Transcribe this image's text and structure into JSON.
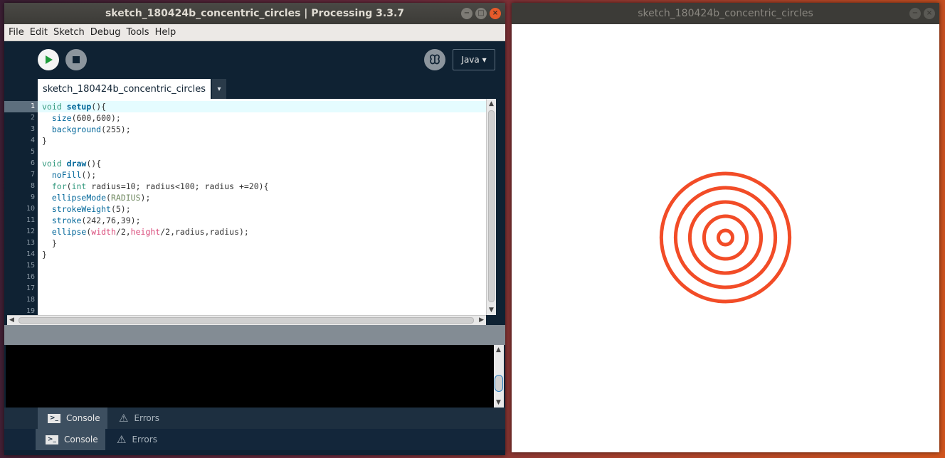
{
  "ide": {
    "title": "sketch_180424b_concentric_circles | Processing 3.3.7",
    "window_buttons": [
      "−",
      "□",
      "×"
    ],
    "menu": [
      "File",
      "Edit",
      "Sketch",
      "Debug",
      "Tools",
      "Help"
    ],
    "toolbar": {
      "run_icon": "play-icon",
      "stop_icon": "stop-icon",
      "debugger_icon": "butterfly-icon",
      "mode": "Java ▾"
    },
    "tab": {
      "label": "sketch_180424b_concentric_circles",
      "menu_arrow": "▾"
    },
    "line_numbers": [
      "1",
      "2",
      "3",
      "4",
      "5",
      "6",
      "7",
      "8",
      "9",
      "10",
      "11",
      "12",
      "13",
      "14",
      "15",
      "16",
      "17",
      "18",
      "19"
    ],
    "code": [
      "void setup(){",
      "  size(600,600);",
      "  background(255);",
      "}",
      "",
      "void draw(){",
      "  noFill();",
      "  for(int radius=10; radius<100; radius +=20){",
      "  ellipseMode(RADIUS);",
      "  strokeWeight(5);",
      "  stroke(242,76,39);",
      "  ellipse(width/2,height/2,radius,radius);",
      "  }",
      "}"
    ],
    "footer_top": {
      "console": "Console",
      "errors": "Errors"
    },
    "footer_bottom": {
      "console": "Console",
      "errors": "Errors"
    }
  },
  "sketch": {
    "title": "sketch_180424b_concentric_circles",
    "window_buttons": [
      "−",
      "×"
    ],
    "stroke_color": "#f24c27",
    "stroke_weight": 5,
    "radii": [
      10,
      30,
      50,
      70,
      90
    ],
    "canvas_size": [
      600,
      600
    ]
  }
}
